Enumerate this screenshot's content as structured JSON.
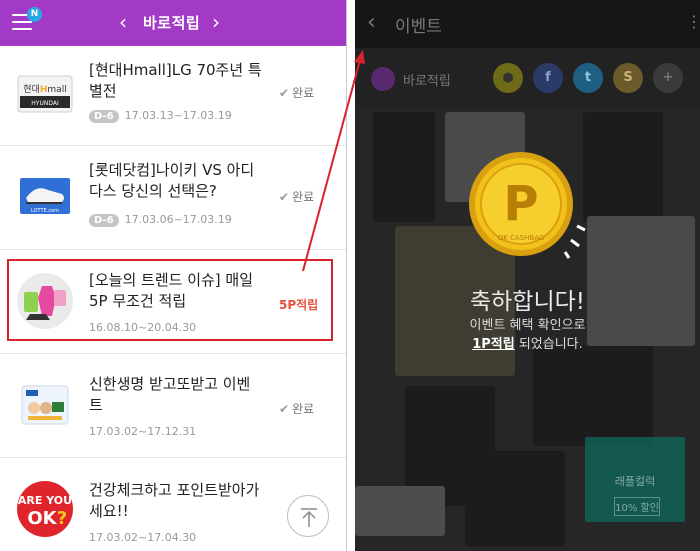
{
  "left_panel": {
    "header": {
      "title": "바로적립",
      "badge": "N"
    },
    "items": [
      {
        "title": "[현대Hmall]LG 70주년 특별전",
        "dday": "D-6",
        "date": "17.03.13~17.03.19",
        "status": "완료",
        "thumb_label": "현대Hmall"
      },
      {
        "title": "[롯데닷컴]나이키 VS 아디다스 당신의 선택은?",
        "dday": "D-6",
        "date": "17.03.06~17.03.19",
        "status": "완료",
        "thumb_label": "LOTTE.com"
      },
      {
        "title": "[오늘의 트렌드 이슈] 매일 5P 무조건 적립",
        "dday": "",
        "date": "16.08.10~20.04.30",
        "status": "5P적립"
      },
      {
        "title": "신한생명 받고또받고 이벤트",
        "dday": "",
        "date": "17.03.02~17.12.31",
        "status": "완료"
      },
      {
        "title": "건강체크하고 포인트받아가세요!!",
        "dday": "",
        "date": "17.03.02~17.04.30",
        "status": "",
        "thumb_label": "ARE YOU OK?"
      }
    ]
  },
  "right_panel": {
    "header_title": "이벤트",
    "share_label": "바로적립",
    "coin_label": "OK CASHBAG",
    "coin_letter": "P",
    "congrats_title": "축하합니다!",
    "congrats_line1": "이벤트 혜택 확인으로",
    "congrats_points": "1P적립",
    "congrats_line2": " 되었습니다.",
    "promo_title": "래플컬럭",
    "promo_badge": "10% 할인"
  },
  "colors": {
    "header_purple": "#a23ac6",
    "highlight_red": "#d8232a",
    "accent_red": "#e8503c",
    "coin_gold": "#f2c21b"
  }
}
